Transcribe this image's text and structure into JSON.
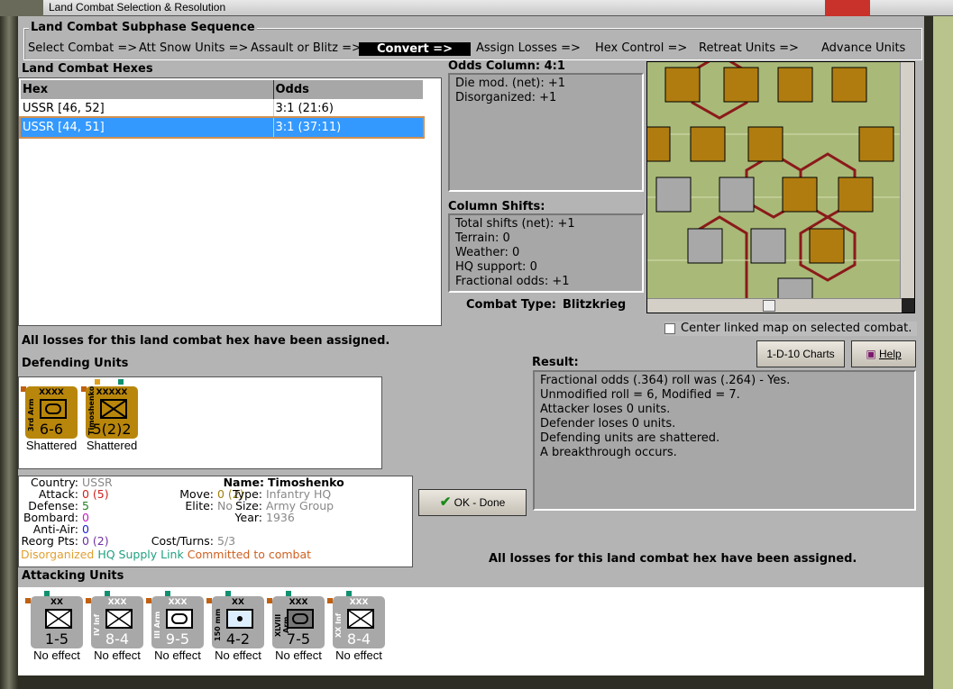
{
  "window": {
    "title": "Land Combat Selection & Resolution"
  },
  "sequence": {
    "title": "Land Combat Subphase Sequence",
    "steps": [
      "Select Combat =>",
      "Att Snow Units =>",
      "Assault or Blitz =>",
      "Convert =>",
      "Assign Losses =>",
      "Hex Control =>",
      "Retreat Units =>",
      "Advance Units"
    ],
    "active_index": 3
  },
  "hexes": {
    "title": "Land Combat Hexes",
    "columns": [
      "Hex",
      "Odds"
    ],
    "rows": [
      {
        "hex": "USSR [46, 52]",
        "odds": "3:1 (21:6)"
      },
      {
        "hex": "USSR [44, 51]",
        "odds": "3:1 (37:11)"
      }
    ],
    "selected_index": 1
  },
  "losses_msg": "All losses for this land combat hex have been assigned.",
  "odds": {
    "title": "Odds Column: 4:1",
    "lines": [
      "Die mod. (net): +1",
      "Disorganized: +1"
    ]
  },
  "shifts": {
    "title": "Column Shifts:",
    "lines": [
      "Total shifts (net): +1",
      "Terrain: 0",
      "Weather: 0",
      "HQ support: 0",
      "Fractional odds: +1"
    ]
  },
  "combat_type": {
    "label": "Combat Type:",
    "value": "Blitzkrieg"
  },
  "center_map": {
    "label": "Center linked map on selected combat.",
    "checked": false
  },
  "buttons": {
    "charts": "1-D-10 Charts",
    "help": "Help",
    "ok": "OK - Done"
  },
  "result": {
    "title": "Result:",
    "lines": [
      "Fractional odds (.364) roll was (.264)  - Yes.",
      "Unmodified roll = 6, Modified = 7.",
      "Attacker loses 0 units.",
      "Defender loses 0 units.",
      "Defending units are shattered.",
      "A breakthrough occurs."
    ]
  },
  "defending": {
    "title": "Defending Units",
    "units": [
      {
        "name": "3rd Arm",
        "level": "XXXX",
        "strength": "6-6",
        "status": "Shattered"
      },
      {
        "name": "Timoshenko",
        "level": "XXXXX",
        "strength": "5(2)2",
        "status": "Shattered"
      }
    ]
  },
  "details": {
    "country_l": "Country:",
    "country": "USSR",
    "attack_l": "Attack:",
    "attack": "0 (5)",
    "defense_l": "Defense:",
    "defense": "5",
    "bombard_l": "Bombard:",
    "bombard": "0",
    "antiair_l": "Anti-Air:",
    "antiair": "0",
    "reorg_l": "Reorg Pts:",
    "reorg": "0 (2)",
    "move_l": "Move:",
    "move": "0 (2)",
    "elite_l": "Elite:",
    "elite": "No",
    "cost_l": "Cost/Turns:",
    "cost": "5/3",
    "name_l": "Name:",
    "name": "Timoshenko",
    "type_l": "Type:",
    "type": "Infantry HQ",
    "size_l": "Size:",
    "size": "Army Group",
    "year_l": "Year:",
    "year": "1936",
    "flag1": "Disorganized",
    "flag2": "HQ Supply Link",
    "flag3": "Committed to combat"
  },
  "attacking": {
    "title": "Attacking Units",
    "units": [
      {
        "name": "",
        "level": "XX",
        "strength": "1-5",
        "status": "No effect"
      },
      {
        "name": "IV Inf",
        "level": "XXX",
        "strength": "8-4",
        "status": "No effect"
      },
      {
        "name": "III Arm",
        "level": "XXX",
        "strength": "9-5",
        "status": "No effect"
      },
      {
        "name": "150 mm",
        "level": "XX",
        "strength": "4-2",
        "status": "No effect"
      },
      {
        "name": "XLVIII Arm",
        "level": "XXX",
        "strength": "7-5",
        "status": "No effect"
      },
      {
        "name": "XX Inf",
        "level": "XXX",
        "strength": "8-4",
        "status": "No effect"
      }
    ]
  },
  "colors": {
    "selected": "#3399ff",
    "ussr_unit": "#b8860b",
    "german_unit": "#a8a8a8",
    "active_step": "#000000"
  }
}
